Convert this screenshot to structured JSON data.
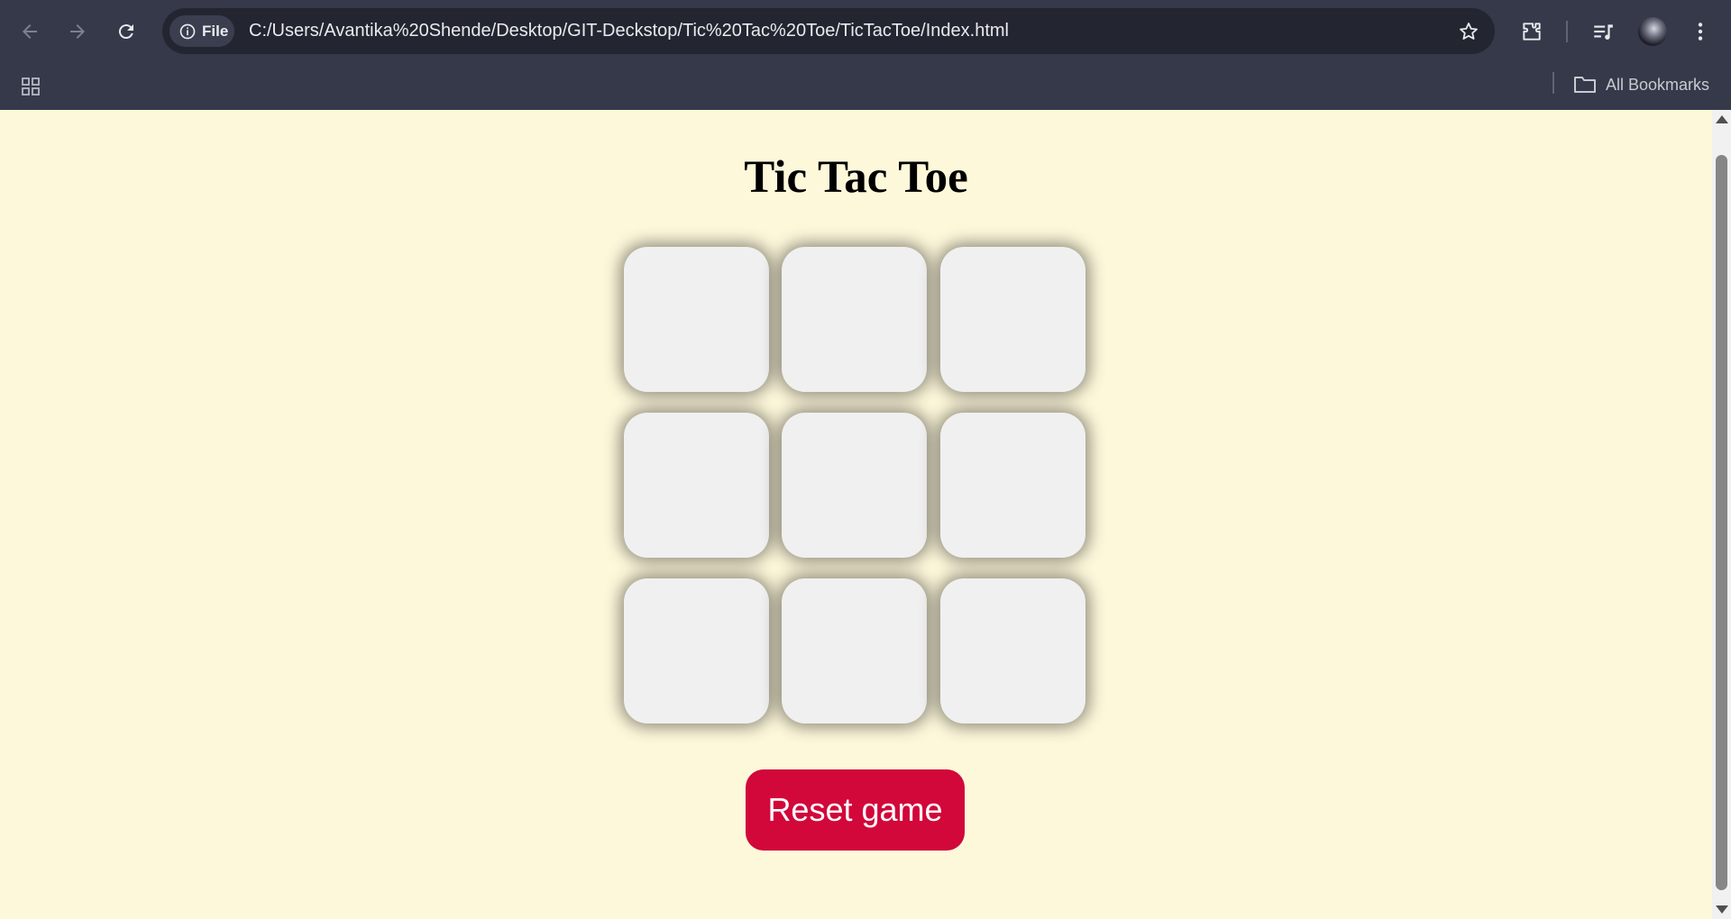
{
  "browser": {
    "url": "C:/Users/Avantika%20Shende/Desktop/GIT-Deckstop/Tic%20Tac%20Toe/TicTacToe/Index.html",
    "scheme_chip": "File",
    "bookmarks_label": "All Bookmarks",
    "icons": [
      "back-arrow-icon",
      "forward-arrow-icon",
      "reload-icon",
      "info-icon",
      "star-icon",
      "extensions-icon",
      "media-queue-icon",
      "profile-avatar",
      "menu-dots-icon",
      "apps-grid-icon",
      "folder-icon"
    ]
  },
  "game": {
    "title": "Tic Tac Toe",
    "cells": [
      "",
      "",
      "",
      "",
      "",
      "",
      "",
      "",
      ""
    ],
    "reset_label": "Reset game"
  },
  "colors": {
    "page_background": "#fef8db",
    "cell_background": "#f0f0f0",
    "reset_button": "#d2073a",
    "chrome_background": "#35394a"
  }
}
